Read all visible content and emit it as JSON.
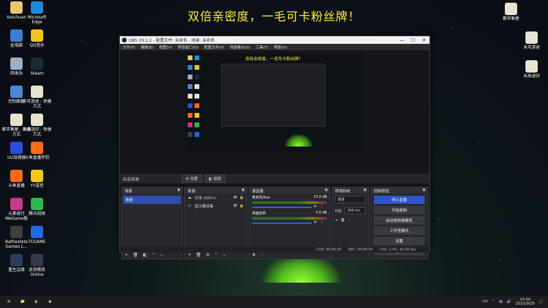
{
  "headline": "双倍亲密度，一毛可卡粉丝牌！",
  "desktop_left": [
    {
      "label": "Isoichuan",
      "color": "#e8c86a"
    },
    {
      "label": "Microsoft Edge",
      "color": "#1e8ad6"
    },
    {
      "label": "此电脑",
      "color": "#3b7fd1"
    },
    {
      "label": "QQ音乐",
      "color": "#f0c419"
    },
    {
      "label": "回收站",
      "color": "#9ab0c8"
    },
    {
      "label": "Steam",
      "color": "#1b2838"
    },
    {
      "label": "控制面板",
      "color": "#4a8ad8"
    },
    {
      "label": "未可游途 - 快捷方式",
      "color": "#e8e2d0"
    },
    {
      "label": "都市售屋 - 快捷方式",
      "color": "#e8e2d0"
    },
    {
      "label": "未来迹印 - 快捷方式",
      "color": "#e8e2d0"
    },
    {
      "label": "UU加速器",
      "color": "#2a4fd8"
    },
    {
      "label": "斗鱼直播伴侣",
      "color": "#ff6a1a"
    },
    {
      "label": "斗鱼直播",
      "color": "#ff6a1a"
    },
    {
      "label": "YY语音",
      "color": "#f5c61f"
    },
    {
      "label": "元素夜行 WeGame版",
      "color": "#c83a8a"
    },
    {
      "label": "腾讯视频",
      "color": "#2cb84a"
    },
    {
      "label": "Battlestate Games L...",
      "color": "#404040"
    },
    {
      "label": "TCGAME",
      "color": "#1f6ae0"
    },
    {
      "label": "重生边缘",
      "color": "#2a3c60"
    },
    {
      "label": "反恐精英 Online",
      "color": "#303a4a"
    }
  ],
  "desktop_right": [
    {
      "label": "都市售屋",
      "color": "#e8e2d0"
    },
    {
      "label": "未可游途",
      "color": "#e8e2d0"
    },
    {
      "label": "未来迹印",
      "color": "#e8e2d0"
    }
  ],
  "obs": {
    "title": "OBS 29.1.2 - 配置文件: 未命名 - 场景: 未命名",
    "menu": [
      "文件(F)",
      "编辑(E)",
      "视图(V)",
      "停靠窗口(D)",
      "配置文件(P)",
      "场景集合(S)",
      "工具(T)",
      "帮助(H)"
    ],
    "preview_inner_title": "双倍亲密度，一毛可卡粉丝牌！",
    "no_source_selected": "未选择源",
    "properties_btn": "设置",
    "filters_btn": "滤镜",
    "scenes": {
      "title": "场景",
      "selected": "场景"
    },
    "sources": {
      "title": "来源",
      "items": [
        {
          "icon": "text-icon",
          "name": "文本 (GDI+)"
        },
        {
          "icon": "monitor-icon",
          "name": "显示器采集"
        }
      ]
    },
    "mixer": {
      "title": "混音器",
      "channels": [
        {
          "name": "麦克风/Aux",
          "db": "15.0 dB"
        },
        {
          "name": "桌面音频",
          "db": "5.0 dB"
        }
      ]
    },
    "transitions": {
      "title": "转场特效",
      "type": "渐变",
      "duration_label": "时长",
      "duration": "300 ms"
    },
    "controls": {
      "title": "控制按钮",
      "buttons": [
        "停止直播",
        "开始录制",
        "启动虚拟摄像机",
        "工作室模式",
        "设置",
        "退出"
      ]
    },
    "status": {
      "live": "LIVE: 00:00:00",
      "rec": "REC: 00:00:00",
      "cpu": "CPU: 2.0%, 60.00 fps"
    }
  },
  "taskbar": {
    "time": "10:00",
    "date": "2023/9/25",
    "lang": "CH"
  }
}
